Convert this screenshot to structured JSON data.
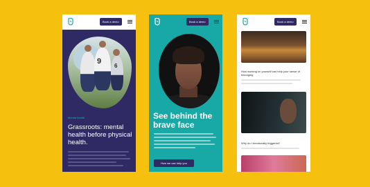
{
  "colors": {
    "background": "#f6c10e",
    "navy": "#2f2a63",
    "teal": "#18a9a6"
  },
  "phone1": {
    "cta_label": "Book a demo",
    "jersey_numbers": [
      "9",
      "6"
    ],
    "kicker": "Mental health",
    "title": "Grassroots: mental health before physical health."
  },
  "phone2": {
    "cta_label": "Book a demo",
    "title": "See behind the brave face",
    "button_label": "How we can help you"
  },
  "phone3": {
    "cta_label": "Book a demo",
    "article1_title": "How working on yourself can help your sense of belonging",
    "article2_title": "Why do I emotionally triggered?"
  },
  "icons": [
    "logo-icon",
    "menu-icon"
  ]
}
